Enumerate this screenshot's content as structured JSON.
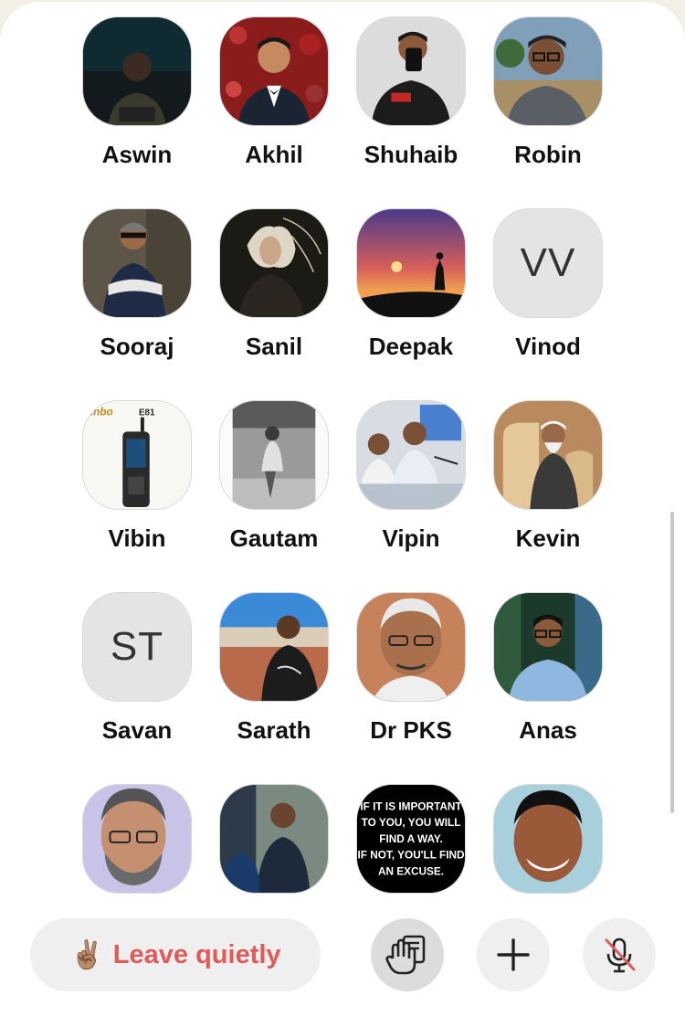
{
  "speakers": [
    {
      "name": "Aswin",
      "initials": ""
    },
    {
      "name": "Akhil",
      "initials": ""
    },
    {
      "name": "Shuhaib",
      "initials": ""
    },
    {
      "name": "Robin",
      "initials": ""
    },
    {
      "name": "Sooraj",
      "initials": ""
    },
    {
      "name": "Sanil",
      "initials": ""
    },
    {
      "name": "Deepak",
      "initials": ""
    },
    {
      "name": "Vinod",
      "initials": "VV"
    },
    {
      "name": "Vibin",
      "initials": ""
    },
    {
      "name": "Gautam",
      "initials": ""
    },
    {
      "name": "Vipin",
      "initials": ""
    },
    {
      "name": "Kevin",
      "initials": ""
    },
    {
      "name": "Savan",
      "initials": "ST"
    },
    {
      "name": "Sarath",
      "initials": ""
    },
    {
      "name": "Dr PKS",
      "initials": ""
    },
    {
      "name": "Anas",
      "initials": ""
    },
    {
      "name": "",
      "initials": ""
    },
    {
      "name": "",
      "initials": ""
    },
    {
      "name": "",
      "initials": "",
      "quote": "IF IT IS IMPORTANT TO YOU, YOU WILL FIND A WAY. IF NOT, YOU'LL FIND AN EXCUSE."
    },
    {
      "name": "",
      "initials": ""
    }
  ],
  "avatar_art": {
    "phone_brand": "unbo",
    "phone_model": "E81",
    "quote_lines": [
      "IF IT IS IMPORTANT",
      "TO YOU, YOU WILL",
      "FIND A WAY.",
      "IF NOT, YOU'LL FIND",
      "AN EXCUSE."
    ]
  },
  "controls": {
    "leave_label": "Leave quietly",
    "leave_emoji": "✌🏽"
  },
  "colors": {
    "leave_text": "#e05a5a",
    "button_bg": "#efefef",
    "mic_slash": "#e05a5a"
  }
}
